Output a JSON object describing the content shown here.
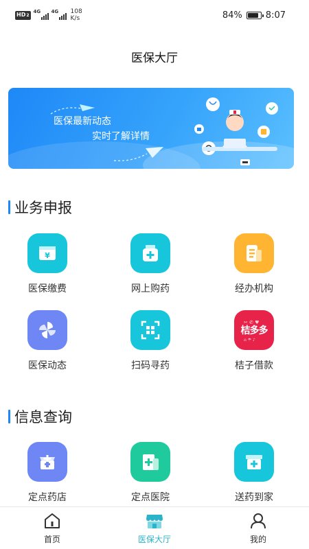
{
  "status_bar": {
    "hd": "HD",
    "hd_sub": "2",
    "net1": "4G",
    "net2": "4G",
    "speed_value": "108",
    "speed_unit": "K/s",
    "battery_text": "84%",
    "battery_level": 0.84,
    "time": "8:07"
  },
  "header": {
    "title": "医保大厅"
  },
  "banner": {
    "line1": "医保最新动态",
    "line2": "实时了解详情"
  },
  "sections": [
    {
      "title": "业务申报",
      "items": [
        {
          "label": "医保缴费",
          "icon": "yen-wallet-icon",
          "color": "#17c6db"
        },
        {
          "label": "网上购药",
          "icon": "medicine-box-icon",
          "color": "#17c6db"
        },
        {
          "label": "经办机构",
          "icon": "document-icon",
          "color": "#ffb432"
        },
        {
          "label": "医保动态",
          "icon": "pinwheel-icon",
          "color": "#6f86f5"
        },
        {
          "label": "扫码寻药",
          "icon": "scan-icon",
          "color": "#17c6db"
        },
        {
          "label": "桔子借款",
          "icon": "pinduoduo-icon",
          "color": "#e8234a",
          "icon_text": "桔多多"
        }
      ]
    },
    {
      "title": "信息查询",
      "items": [
        {
          "label": "定点药店",
          "icon": "pharmacy-store-icon",
          "color": "#6f86f5"
        },
        {
          "label": "定点医院",
          "icon": "hospital-icon",
          "color": "#1fcb9c"
        },
        {
          "label": "送药到家",
          "icon": "delivery-box-icon",
          "color": "#17c6db"
        }
      ]
    }
  ],
  "tabs": [
    {
      "label": "首页",
      "icon": "home-icon",
      "active": false
    },
    {
      "label": "医保大厅",
      "icon": "store-icon",
      "active": true
    },
    {
      "label": "我的",
      "icon": "user-icon",
      "active": false
    }
  ],
  "colors": {
    "accent": "#2bb3c9",
    "section_bar": "#1e88f7"
  }
}
